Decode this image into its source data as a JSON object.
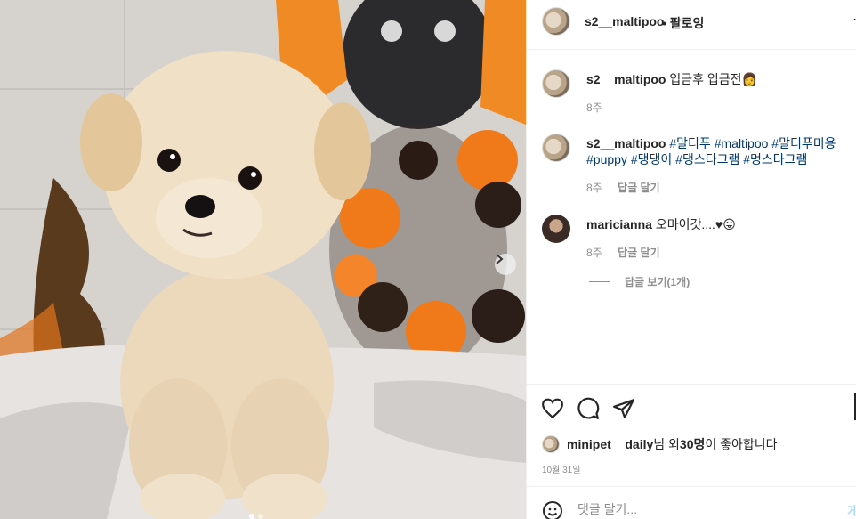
{
  "post": {
    "username": "s2__maltipoo",
    "follow_label": "• 팔로잉",
    "more_label": "⋯"
  },
  "comments": [
    {
      "username": "s2__maltipoo",
      "text": "입금후 입금전",
      "emoji": "👩",
      "time": "8주"
    },
    {
      "username": "s2__maltipoo",
      "tags": [
        "#말티푸",
        "#maltipoo",
        "#말티푸미용",
        "#puppy",
        "#댕댕이",
        "#댕스타그램",
        "#멍스타그램"
      ],
      "time": "8주",
      "reply_label": "답글 달기"
    },
    {
      "username": "maricianna",
      "text": "오마이갓....♥",
      "emoji": "😛",
      "time": "8주",
      "reply_label": "답글 달기"
    }
  ],
  "view_replies_label": "답글 보기(1개)",
  "likes": {
    "username": "minipet__daily",
    "suffix_1": "님 외 ",
    "count": "30명",
    "suffix_2": "이 좋아합니다"
  },
  "date": "10월 31일",
  "add_comment": {
    "placeholder": "댓글 달기...",
    "post_label": "게"
  },
  "icons": [
    "heart-icon",
    "comment-icon",
    "share-icon",
    "emoji-icon",
    "chevron-right-icon"
  ],
  "colors": {
    "hashtag": "#00376b",
    "meta": "#8e8e8e",
    "border": "#efefef"
  }
}
